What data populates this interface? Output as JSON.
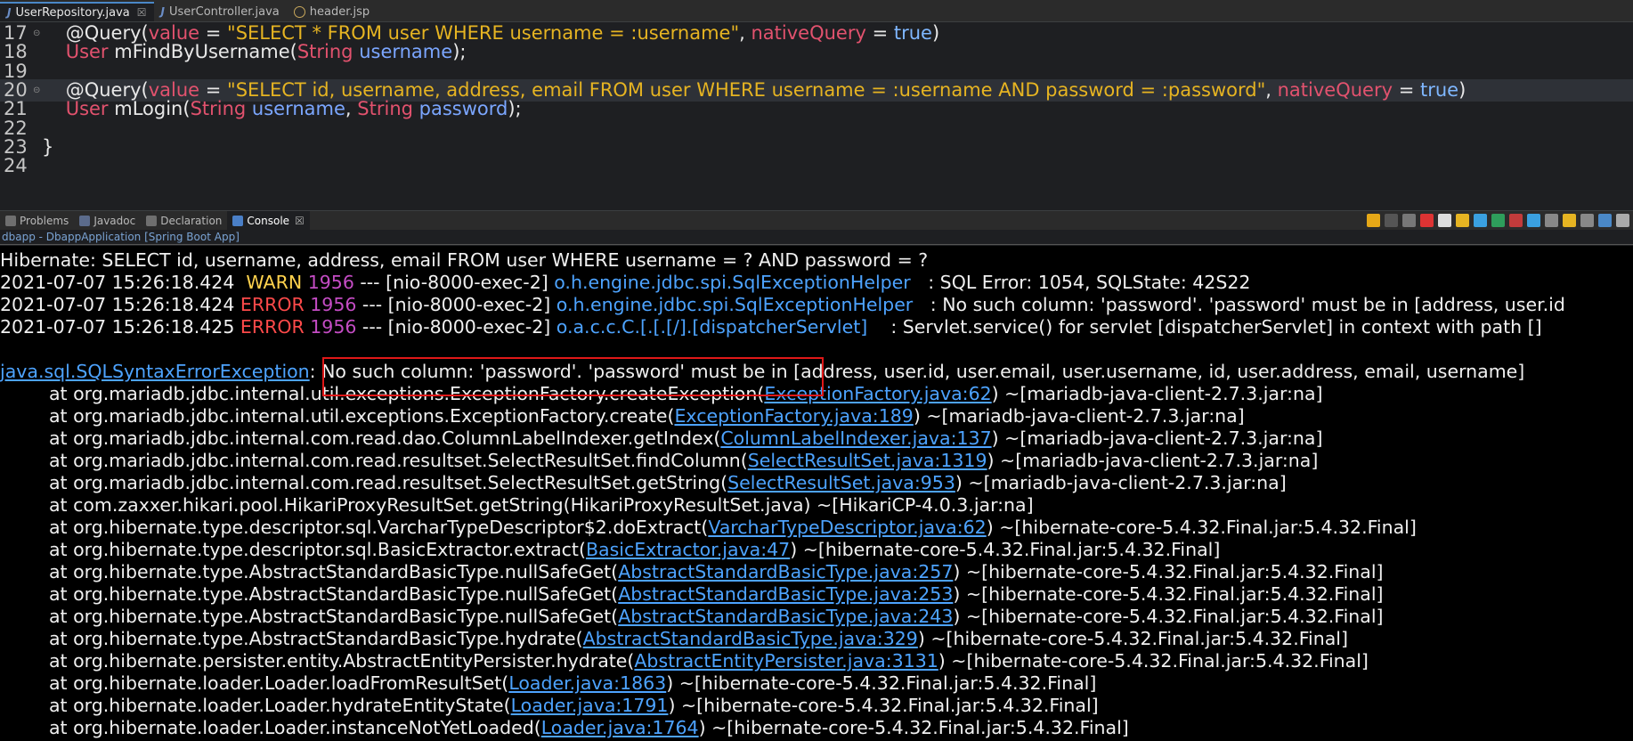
{
  "editor_tabs": [
    {
      "label": "UserRepository.java",
      "active": true,
      "icon": "java-file-icon"
    },
    {
      "label": "UserController.java",
      "active": false,
      "icon": "java-file-icon"
    },
    {
      "label": "header.jsp",
      "active": false,
      "icon": "jsp-file-icon"
    }
  ],
  "code": {
    "lines": [
      {
        "num": "17",
        "fold": true,
        "segments": [
          [
            "    ",
            "plain"
          ],
          [
            "@Query(",
            "ann"
          ],
          [
            "value",
            "attr"
          ],
          [
            " = ",
            "plain"
          ],
          [
            "\"SELECT * FROM user WHERE username = :username\"",
            "str"
          ],
          [
            ", ",
            "plain"
          ],
          [
            "nativeQuery",
            "attr"
          ],
          [
            " = ",
            "plain"
          ],
          [
            "true",
            "bool"
          ],
          [
            ")",
            "plain"
          ]
        ]
      },
      {
        "num": "18",
        "fold": false,
        "segments": [
          [
            "    ",
            "plain"
          ],
          [
            "User",
            "type"
          ],
          [
            " mFindByUsername(",
            "plain"
          ],
          [
            "String",
            "type"
          ],
          [
            " ",
            "plain"
          ],
          [
            "username",
            "var"
          ],
          [
            ");",
            "plain"
          ]
        ]
      },
      {
        "num": "19",
        "fold": false,
        "segments": []
      },
      {
        "num": "20",
        "fold": true,
        "highlight": true,
        "segments": [
          [
            "    ",
            "plain"
          ],
          [
            "@Query(",
            "ann"
          ],
          [
            "value",
            "attr"
          ],
          [
            " = ",
            "plain"
          ],
          [
            "\"SELECT id, username, address, email FROM user WHERE username = :username AND password = :password\"",
            "str"
          ],
          [
            ", ",
            "plain"
          ],
          [
            "nativeQuery",
            "attr"
          ],
          [
            " = ",
            "plain"
          ],
          [
            "true",
            "bool"
          ],
          [
            ")",
            "plain"
          ]
        ]
      },
      {
        "num": "21",
        "fold": false,
        "segments": [
          [
            "    ",
            "plain"
          ],
          [
            "User",
            "type"
          ],
          [
            " mLogin(",
            "plain"
          ],
          [
            "String",
            "type"
          ],
          [
            " ",
            "plain"
          ],
          [
            "username",
            "var"
          ],
          [
            ", ",
            "plain"
          ],
          [
            "String",
            "type"
          ],
          [
            " ",
            "plain"
          ],
          [
            "password",
            "var"
          ],
          [
            ");",
            "plain"
          ]
        ]
      },
      {
        "num": "22",
        "fold": false,
        "segments": []
      },
      {
        "num": "23",
        "fold": false,
        "segments": [
          [
            "}",
            "plain"
          ]
        ]
      },
      {
        "num": "24",
        "fold": false,
        "segments": []
      }
    ]
  },
  "panel_tabs": [
    {
      "label": "Problems",
      "icon": "problems-icon",
      "active": false
    },
    {
      "label": "Javadoc",
      "icon": "javadoc-icon",
      "active": false
    },
    {
      "label": "Declaration",
      "icon": "declaration-icon",
      "active": false
    },
    {
      "label": "Console",
      "icon": "console-icon",
      "active": true
    }
  ],
  "console_title": "dbapp - DbappApplication [Spring Boot App]",
  "toolbar_icons": [
    "sync-icon",
    "terminate-icon",
    "remove-launch-icon",
    "stop-icon",
    "clear-console-icon",
    "scroll-lock-icon",
    "word-wrap-icon",
    "show-on-stdout-icon",
    "show-on-stderr-icon",
    "pin-console-icon",
    "display-console-icon",
    "new-console-icon",
    "copy-icon",
    "link-icon",
    "settings-icon"
  ],
  "console": {
    "hibernate_line": "Hibernate: SELECT id, username, address, email FROM user WHERE username = ? AND password = ?",
    "log_lines": [
      {
        "ts": "2021-07-07 15:26:18.424",
        "level": " WARN",
        "pid": "1956",
        "thread": " --- [nio-8000-exec-2] ",
        "logger": "o.h.engine.jdbc.spi.SqlExceptionHelper",
        "msg": "   : SQL Error: 1054, SQLState: 42S22"
      },
      {
        "ts": "2021-07-07 15:26:18.424",
        "level": "ERROR",
        "pid": "1956",
        "thread": " --- [nio-8000-exec-2] ",
        "logger": "o.h.engine.jdbc.spi.SqlExceptionHelper",
        "msg": "   : No such column: 'password'. 'password' must be in [address, user.id"
      },
      {
        "ts": "2021-07-07 15:26:18.425",
        "level": "ERROR",
        "pid": "1956",
        "thread": " --- [nio-8000-exec-2] ",
        "logger": "o.a.c.c.C.[.[.[/].[dispatcherServlet]",
        "msg": "    : Servlet.service() for servlet [dispatcherServlet] in context with path []"
      }
    ],
    "exception": {
      "class": "java.sql.SQLSyntaxErrorException",
      "msg": ": No such column: 'password'. 'password' must be in [address, user.id, user.email, user.username, id, user.address, email, username]"
    },
    "frames": [
      {
        "pre": "at org.mariadb.jdbc.internal.util.exceptions.ExceptionFactory.createException(",
        "link": "ExceptionFactory.java:62",
        "post": ") ~[mariadb-java-client-2.7.3.jar:na]"
      },
      {
        "pre": "at org.mariadb.jdbc.internal.util.exceptions.ExceptionFactory.create(",
        "link": "ExceptionFactory.java:189",
        "post": ") ~[mariadb-java-client-2.7.3.jar:na]"
      },
      {
        "pre": "at org.mariadb.jdbc.internal.com.read.dao.ColumnLabelIndexer.getIndex(",
        "link": "ColumnLabelIndexer.java:137",
        "post": ") ~[mariadb-java-client-2.7.3.jar:na]"
      },
      {
        "pre": "at org.mariadb.jdbc.internal.com.read.resultset.SelectResultSet.findColumn(",
        "link": "SelectResultSet.java:1319",
        "post": ") ~[mariadb-java-client-2.7.3.jar:na]"
      },
      {
        "pre": "at org.mariadb.jdbc.internal.com.read.resultset.SelectResultSet.getString(",
        "link": "SelectResultSet.java:953",
        "post": ") ~[mariadb-java-client-2.7.3.jar:na]"
      },
      {
        "pre": "at com.zaxxer.hikari.pool.HikariProxyResultSet.getString(HikariProxyResultSet.java) ~[HikariCP-4.0.3.jar:na]",
        "link": "",
        "post": ""
      },
      {
        "pre": "at org.hibernate.type.descriptor.sql.VarcharTypeDescriptor$2.doExtract(",
        "link": "VarcharTypeDescriptor.java:62",
        "post": ") ~[hibernate-core-5.4.32.Final.jar:5.4.32.Final]"
      },
      {
        "pre": "at org.hibernate.type.descriptor.sql.BasicExtractor.extract(",
        "link": "BasicExtractor.java:47",
        "post": ") ~[hibernate-core-5.4.32.Final.jar:5.4.32.Final]"
      },
      {
        "pre": "at org.hibernate.type.AbstractStandardBasicType.nullSafeGet(",
        "link": "AbstractStandardBasicType.java:257",
        "post": ") ~[hibernate-core-5.4.32.Final.jar:5.4.32.Final]"
      },
      {
        "pre": "at org.hibernate.type.AbstractStandardBasicType.nullSafeGet(",
        "link": "AbstractStandardBasicType.java:253",
        "post": ") ~[hibernate-core-5.4.32.Final.jar:5.4.32.Final]"
      },
      {
        "pre": "at org.hibernate.type.AbstractStandardBasicType.nullSafeGet(",
        "link": "AbstractStandardBasicType.java:243",
        "post": ") ~[hibernate-core-5.4.32.Final.jar:5.4.32.Final]"
      },
      {
        "pre": "at org.hibernate.type.AbstractStandardBasicType.hydrate(",
        "link": "AbstractStandardBasicType.java:329",
        "post": ") ~[hibernate-core-5.4.32.Final.jar:5.4.32.Final]"
      },
      {
        "pre": "at org.hibernate.persister.entity.AbstractEntityPersister.hydrate(",
        "link": "AbstractEntityPersister.java:3131",
        "post": ") ~[hibernate-core-5.4.32.Final.jar:5.4.32.Final]"
      },
      {
        "pre": "at org.hibernate.loader.Loader.loadFromResultSet(",
        "link": "Loader.java:1863",
        "post": ") ~[hibernate-core-5.4.32.Final.jar:5.4.32.Final]"
      },
      {
        "pre": "at org.hibernate.loader.Loader.hydrateEntityState(",
        "link": "Loader.java:1791",
        "post": ") ~[hibernate-core-5.4.32.Final.jar:5.4.32.Final]"
      },
      {
        "pre": "at org.hibernate.loader.Loader.instanceNotYetLoaded(",
        "link": "Loader.java:1764",
        "post": ") ~[hibernate-core-5.4.32.Final.jar:5.4.32.Final]"
      }
    ]
  },
  "colors": {
    "warn": "#ffd24d",
    "error": "#ff4a4a",
    "pid": "#c44cc4",
    "link": "#4da3ff",
    "highlight_box": "#e01818"
  }
}
